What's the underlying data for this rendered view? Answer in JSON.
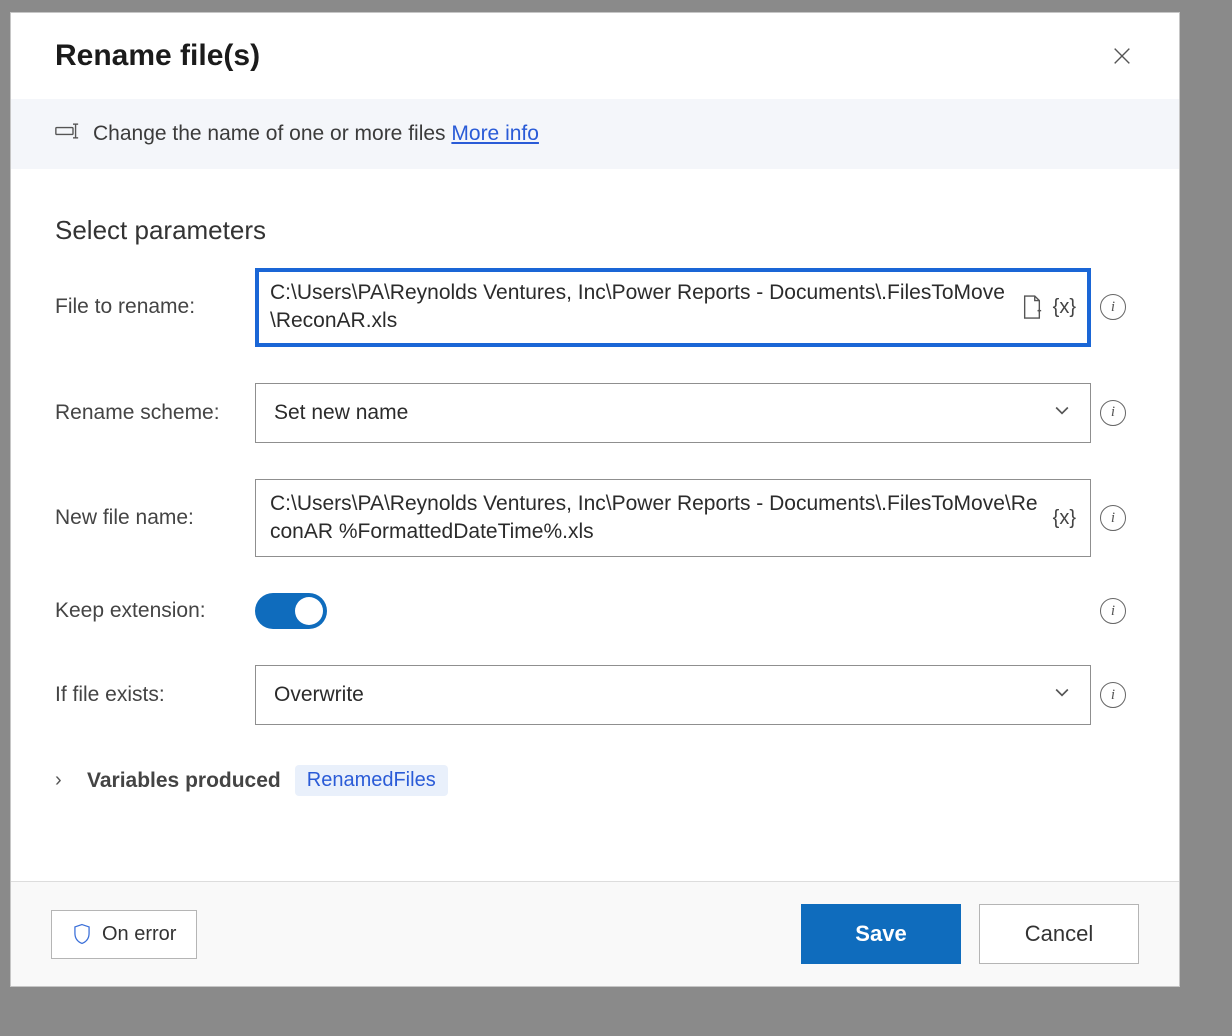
{
  "dialog": {
    "title": "Rename file(s)",
    "description": "Change the name of one or more files",
    "more_info": "More info"
  },
  "section_heading": "Select parameters",
  "fields": {
    "file_to_rename": {
      "label": "File to rename:",
      "value": "C:\\Users\\PA\\Reynolds Ventures, Inc\\Power Reports - Documents\\.FilesToMove\\ReconAR.xls"
    },
    "rename_scheme": {
      "label": "Rename scheme:",
      "value": "Set new name"
    },
    "new_file_name": {
      "label": "New file name:",
      "value": "C:\\Users\\PA\\Reynolds Ventures, Inc\\Power Reports - Documents\\.FilesToMove\\ReconAR %FormattedDateTime%.xls"
    },
    "keep_extension": {
      "label": "Keep extension:",
      "value": true
    },
    "if_file_exists": {
      "label": "If file exists:",
      "value": "Overwrite"
    }
  },
  "variables_produced": {
    "label": "Variables produced",
    "variable": "RenamedFiles"
  },
  "footer": {
    "on_error": "On error",
    "save": "Save",
    "cancel": "Cancel"
  },
  "tokens": {
    "variable": "{x}"
  }
}
